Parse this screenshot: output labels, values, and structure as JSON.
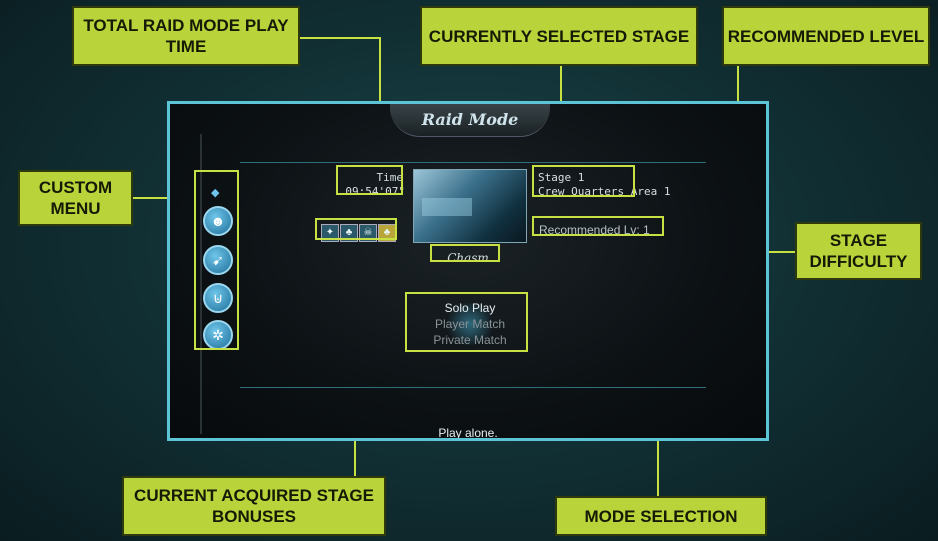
{
  "callouts": {
    "play_time": "TOTAL RAID MODE PLAY TIME",
    "selected_stage": "CURRENTLY SELECTED STAGE",
    "recommended_level": "RECOMMENDED LEVEL",
    "custom_menu": "CUSTOM MENU",
    "stage_difficulty": "STAGE DIFFICULTY",
    "stage_bonuses": "CURRENT ACQUIRED STAGE BONUSES",
    "mode_selection": "MODE SELECTION"
  },
  "screen": {
    "title": "Raid Mode",
    "time_label": "Time",
    "time_value": "09:54'07\"",
    "stage_label": "Stage 1",
    "stage_name": "Crew Quarters Area 1",
    "recommended": "Recommended Lv: 1",
    "difficulty": "Chasm",
    "modes": [
      "Solo Play",
      "Player Match",
      "Private Match"
    ],
    "selected_mode": "Solo Play",
    "description": "Play alone."
  },
  "colors": {
    "callout": "#b9d43a",
    "screen_border": "#5cc4d6"
  }
}
